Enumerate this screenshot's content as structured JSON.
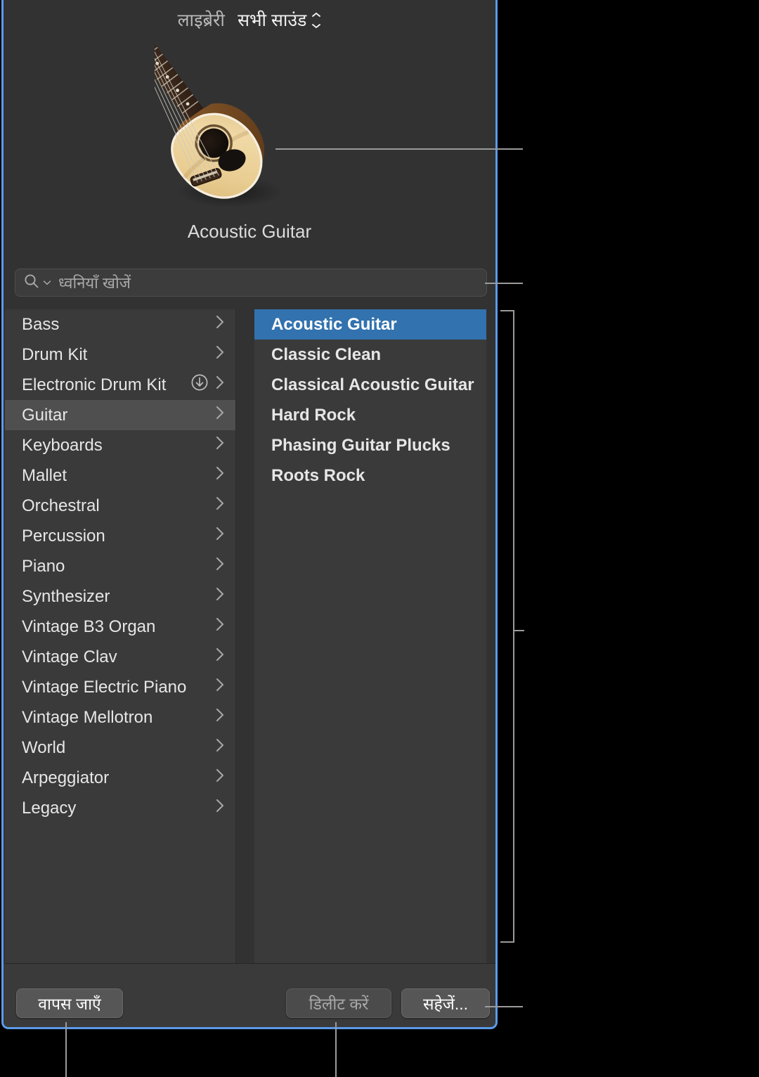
{
  "header": {
    "library_label": "लाइब्रेरी",
    "sound_selector_label": "सभी साउंड",
    "selector_icon": "up-down-chevron-icon"
  },
  "preview": {
    "instrument_name": "Acoustic Guitar",
    "artwork_icon": "acoustic-guitar-image"
  },
  "search": {
    "placeholder": "ध्वनियाँ खोजें",
    "value": "",
    "icon": "search-icon",
    "dropdown_icon": "chevron-down-icon"
  },
  "browser": {
    "categories": [
      {
        "label": "Bass",
        "selected": false,
        "download": false
      },
      {
        "label": "Drum Kit",
        "selected": false,
        "download": false
      },
      {
        "label": "Electronic Drum Kit",
        "selected": false,
        "download": true
      },
      {
        "label": "Guitar",
        "selected": true,
        "download": false
      },
      {
        "label": "Keyboards",
        "selected": false,
        "download": false
      },
      {
        "label": "Mallet",
        "selected": false,
        "download": false
      },
      {
        "label": "Orchestral",
        "selected": false,
        "download": false
      },
      {
        "label": "Percussion",
        "selected": false,
        "download": false
      },
      {
        "label": "Piano",
        "selected": false,
        "download": false
      },
      {
        "label": "Synthesizer",
        "selected": false,
        "download": false
      },
      {
        "label": "Vintage B3 Organ",
        "selected": false,
        "download": false
      },
      {
        "label": "Vintage Clav",
        "selected": false,
        "download": false
      },
      {
        "label": "Vintage Electric Piano",
        "selected": false,
        "download": false
      },
      {
        "label": "Vintage Mellotron",
        "selected": false,
        "download": false
      },
      {
        "label": "World",
        "selected": false,
        "download": false
      },
      {
        "label": "Arpeggiator",
        "selected": false,
        "download": false
      },
      {
        "label": "Legacy",
        "selected": false,
        "download": false
      }
    ],
    "patches": [
      {
        "label": "Acoustic Guitar",
        "selected": true
      },
      {
        "label": "Classic Clean",
        "selected": false
      },
      {
        "label": "Classical Acoustic Guitar",
        "selected": false
      },
      {
        "label": "Hard Rock",
        "selected": false
      },
      {
        "label": "Phasing Guitar Plucks",
        "selected": false
      },
      {
        "label": "Roots Rock",
        "selected": false
      }
    ]
  },
  "footer": {
    "revert_label": "वापस जाएँ",
    "delete_label": "डिलीट करें",
    "save_label": "सहेजें..."
  },
  "colors": {
    "selection_blue": "#3272ae",
    "window_border_blue": "#5b9bea",
    "panel_bg": "#3a3a3a",
    "window_bg": "#323232",
    "callout_line": "#9b9b9b"
  }
}
